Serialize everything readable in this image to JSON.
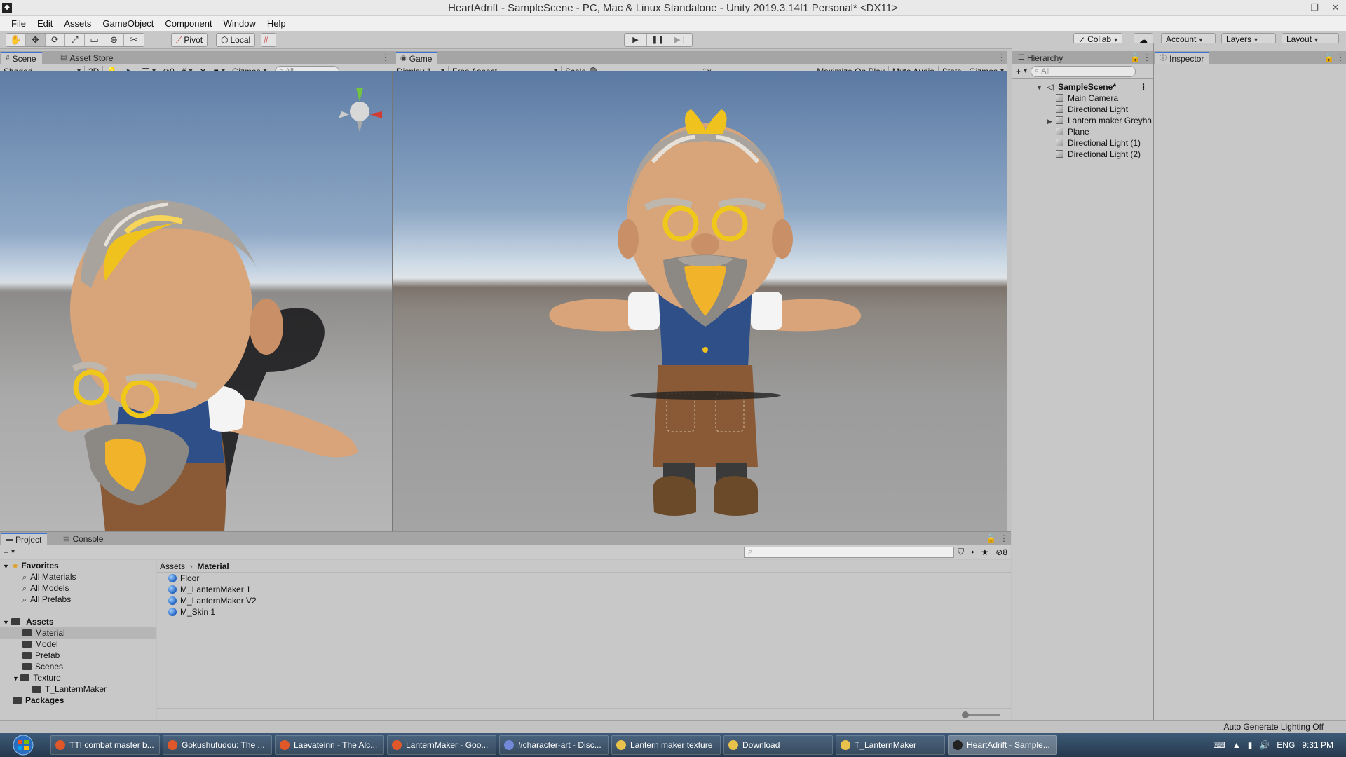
{
  "window": {
    "title": "HeartAdrift - SampleScene - PC, Mac & Linux Standalone - Unity 2019.3.14f1 Personal* <DX11>"
  },
  "menu": [
    "File",
    "Edit",
    "Assets",
    "GameObject",
    "Component",
    "Window",
    "Help"
  ],
  "toolbar": {
    "pivot": "Pivot",
    "local": "Local",
    "collab": "Collab",
    "account": "Account",
    "layers": "Layers",
    "layout": "Layout"
  },
  "scene_panel": {
    "tab_scene": "Scene",
    "tab_asset_store": "Asset Store",
    "shading_mode": "Shaded",
    "mode_2d": "2D",
    "hidden_count": "0",
    "gizmos": "Gizmos",
    "search_placeholder": "All"
  },
  "game_panel": {
    "tab_game": "Game",
    "display": "Display 1",
    "aspect": "Free Aspect",
    "scale_label": "Scale",
    "scale_value": "1x",
    "scale_level": 0,
    "maximize_on_play": "Maximize On Play",
    "mute_audio": "Mute Audio",
    "stats": "Stats",
    "gizmos": "Gizmos"
  },
  "hierarchy": {
    "tab": "Hierarchy",
    "search_placeholder": "All",
    "scene": "SampleScene*",
    "items": [
      {
        "label": "Main Camera",
        "expandable": false
      },
      {
        "label": "Directional Light",
        "expandable": false
      },
      {
        "label": "Lantern maker Greyha",
        "expandable": true
      },
      {
        "label": "Plane",
        "expandable": false
      },
      {
        "label": "Directional Light (1)",
        "expandable": false
      },
      {
        "label": "Directional Light (2)",
        "expandable": false
      }
    ]
  },
  "inspector": {
    "tab": "Inspector"
  },
  "project_panel": {
    "tab_project": "Project",
    "tab_console": "Console",
    "hidden_packages_count": "8",
    "favorites": {
      "label": "Favorites",
      "items": [
        "All Materials",
        "All Models",
        "All Prefabs"
      ]
    },
    "assets": {
      "label": "Assets",
      "folders": [
        "Material",
        "Model",
        "Prefab",
        "Scenes",
        "Texture"
      ],
      "texture_children": [
        "T_LanternMaker"
      ],
      "selected": "Material"
    },
    "packages": "Packages",
    "breadcrumb": [
      "Assets",
      "Material"
    ],
    "files": [
      "Floor",
      "M_LanternMaker 1",
      "M_LanternMaker V2",
      "M_Skin 1"
    ]
  },
  "statusbar": {
    "text": "Auto Generate Lighting Off"
  },
  "taskbar": {
    "tasks": [
      {
        "label": "TTI combat master b...",
        "color": "#e0582a",
        "active": false
      },
      {
        "label": "Gokushufudou: The ...",
        "color": "#e0582a",
        "active": false
      },
      {
        "label": "Laevateinn - The Alc...",
        "color": "#e0582a",
        "active": false
      },
      {
        "label": "LanternMaker - Goo...",
        "color": "#e0582a",
        "active": false
      },
      {
        "label": "#character-art - Disc...",
        "color": "#7289da",
        "active": false
      },
      {
        "label": "Lantern maker texture",
        "color": "#e8c24a",
        "active": false
      },
      {
        "label": "Download",
        "color": "#e8c24a",
        "active": false
      },
      {
        "label": "T_LanternMaker",
        "color": "#e8c24a",
        "active": false
      },
      {
        "label": "HeartAdrift - Sample...",
        "color": "#222222",
        "active": true
      }
    ],
    "tray": {
      "language": "ENG",
      "time": "9:31 PM"
    }
  }
}
